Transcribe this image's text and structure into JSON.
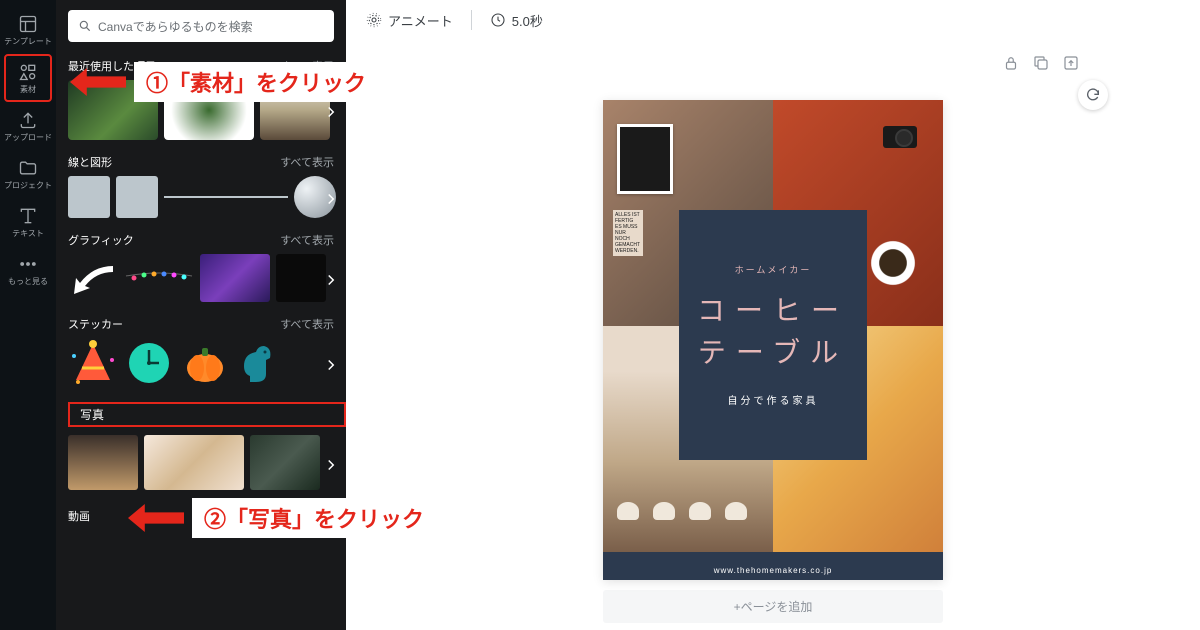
{
  "rail": {
    "template": "テンプレート",
    "elements": "素材",
    "upload": "アップロード",
    "project": "プロジェクト",
    "text": "テキスト",
    "more": "もっと見る"
  },
  "search": {
    "placeholder": "Canvaであらゆるものを検索"
  },
  "sections": {
    "recent": "最近使用した項目",
    "lines_shapes": "線と図形",
    "graphics": "グラフィック",
    "stickers": "ステッカー",
    "photos": "写真",
    "video": "動画"
  },
  "see_all": "すべて表示",
  "topbar": {
    "animate": "アニメート",
    "duration": "5.0秒"
  },
  "document": {
    "subtitle": "ホームメイカー",
    "title1": "コーヒー",
    "title2": "テーブル",
    "diy": "自分で作る家具",
    "url": "www.thehomemakers.co.jp",
    "poster_text": "ALLES IST FERTIG ES MUSS NUR NOCH GEMACHT WERDEN."
  },
  "add_page": "+ページを追加",
  "annotations": {
    "a1": "①「素材」をクリック",
    "a2": "②「写真」をクリック"
  }
}
